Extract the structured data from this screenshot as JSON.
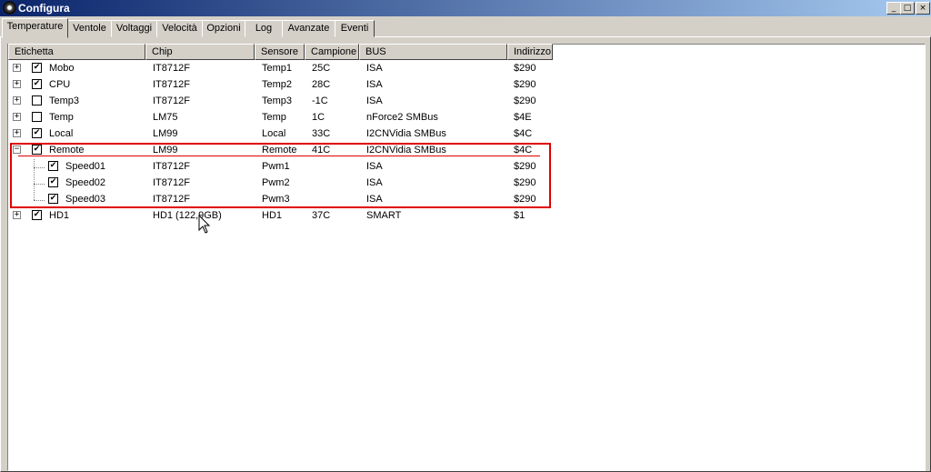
{
  "window": {
    "title": "Configura"
  },
  "tabs": [
    {
      "label": "Temperature",
      "active": true
    },
    {
      "label": "Ventole"
    },
    {
      "label": "Voltaggi"
    },
    {
      "label": "Velocità"
    },
    {
      "label": "Opzioni"
    },
    {
      "label": "Log"
    },
    {
      "label": "Avanzate"
    },
    {
      "label": "Eventi"
    }
  ],
  "columns": [
    "Etichetta",
    "Chip",
    "Sensore",
    "Campione",
    "BUS",
    "Indirizzo"
  ],
  "rows": [
    {
      "label": "Mobo",
      "chip": "IT8712F",
      "sensor": "Temp1",
      "sample": "25C",
      "bus": "ISA",
      "address": "$290",
      "checked": true,
      "expander": "+"
    },
    {
      "label": "CPU",
      "chip": "IT8712F",
      "sensor": "Temp2",
      "sample": "28C",
      "bus": "ISA",
      "address": "$290",
      "checked": true,
      "expander": "+"
    },
    {
      "label": "Temp3",
      "chip": "IT8712F",
      "sensor": "Temp3",
      "sample": "-1C",
      "bus": "ISA",
      "address": "$290",
      "checked": false,
      "expander": "+"
    },
    {
      "label": "Temp",
      "chip": "LM75",
      "sensor": "Temp",
      "sample": "1C",
      "bus": "nForce2 SMBus",
      "address": "$4E",
      "checked": false,
      "expander": "+"
    },
    {
      "label": "Local",
      "chip": "LM99",
      "sensor": "Local",
      "sample": "33C",
      "bus": "I2CNVidia SMBus",
      "address": "$4C",
      "checked": true,
      "expander": "+"
    },
    {
      "label": "Remote",
      "chip": "LM99",
      "sensor": "Remote",
      "sample": "41C",
      "bus": "I2CNVidia SMBus",
      "address": "$4C",
      "checked": true,
      "expander": "−"
    },
    {
      "label": "Speed01",
      "chip": "IT8712F",
      "sensor": "Pwm1",
      "sample": "",
      "bus": "ISA",
      "address": "$290",
      "checked": true,
      "child": true
    },
    {
      "label": "Speed02",
      "chip": "IT8712F",
      "sensor": "Pwm2",
      "sample": "",
      "bus": "ISA",
      "address": "$290",
      "checked": true,
      "child": true
    },
    {
      "label": "Speed03",
      "chip": "IT8712F",
      "sensor": "Pwm3",
      "sample": "",
      "bus": "ISA",
      "address": "$290",
      "checked": true,
      "child": true
    },
    {
      "label": "HD1",
      "chip": "HD1 (122,9GB)",
      "sensor": "HD1",
      "sample": "37C",
      "bus": "SMART",
      "address": "$1",
      "checked": true,
      "expander": "+"
    }
  ],
  "window_buttons": {
    "minimize": "_",
    "maximize": "□",
    "close": "×"
  },
  "checkmark": "✔"
}
